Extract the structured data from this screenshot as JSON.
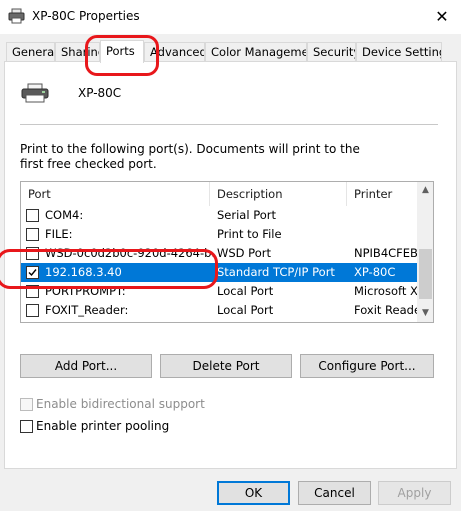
{
  "window": {
    "title": "XP-80C Properties",
    "close_glyph": "✕"
  },
  "tabs": [
    {
      "label": "General",
      "active": false
    },
    {
      "label": "Sharing",
      "active": false
    },
    {
      "label": "Ports",
      "active": true
    },
    {
      "label": "Advanced",
      "active": false
    },
    {
      "label": "Color Management",
      "active": false
    },
    {
      "label": "Security",
      "active": false
    },
    {
      "label": "Device Settings",
      "active": false
    }
  ],
  "printer": {
    "name": "XP-80C",
    "icon": "printer-icon"
  },
  "ports": {
    "description": "Print to the following port(s). Documents will print to the first free checked port.",
    "columns": {
      "port": "Port",
      "description": "Description",
      "printer": "Printer"
    },
    "rows": [
      {
        "port": "COM4:",
        "description": "Serial Port",
        "printer": "",
        "checked": false,
        "selected": false
      },
      {
        "port": "FILE:",
        "description": "Print to File",
        "printer": "",
        "checked": false,
        "selected": false
      },
      {
        "port": "WSD-0c0d2b0c-920d-4264-b...",
        "description": "WSD Port",
        "printer": "NPIB4CFEB",
        "checked": false,
        "selected": false
      },
      {
        "port": "192.168.3.40",
        "description": "Standard TCP/IP Port",
        "printer": "XP-80C",
        "checked": true,
        "selected": true
      },
      {
        "port": "PORTPROMPT:",
        "description": "Local Port",
        "printer": "Microsoft X",
        "checked": false,
        "selected": false
      },
      {
        "port": "FOXIT_Reader:",
        "description": "Local Port",
        "printer": "Foxit Reader",
        "checked": false,
        "selected": false
      }
    ]
  },
  "buttons": {
    "add_port": "Add Port...",
    "delete_port": "Delete Port",
    "configure_port": "Configure Port..."
  },
  "options": {
    "bidirectional": {
      "label": "Enable bidirectional support",
      "checked": false,
      "enabled": false
    },
    "pooling": {
      "label": "Enable printer pooling",
      "checked": false,
      "enabled": true
    }
  },
  "dialog_buttons": {
    "ok": "OK",
    "cancel": "Cancel",
    "apply": "Apply"
  },
  "colors": {
    "selection": "#0078d7",
    "annotation": "#e8171b"
  }
}
